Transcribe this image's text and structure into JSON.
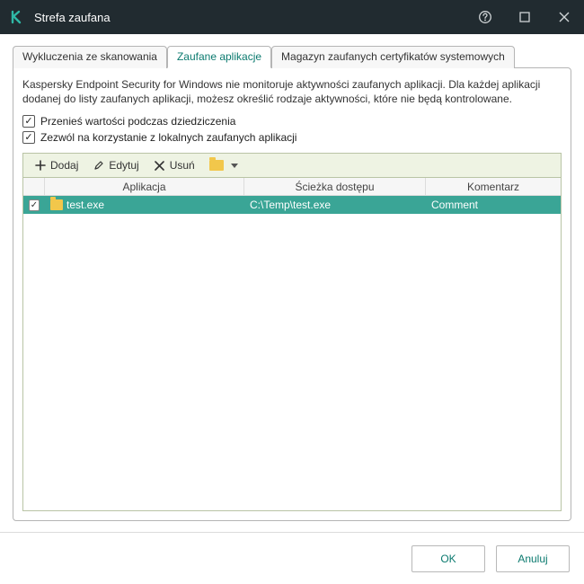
{
  "window": {
    "title": "Strefa zaufana"
  },
  "tabs": {
    "scan_exclusions": "Wykluczenia ze skanowania",
    "trusted_apps": "Zaufane aplikacje",
    "sys_certs": "Magazyn zaufanych certyfikatów systemowych"
  },
  "description": "Kaspersky Endpoint Security for Windows nie monitoruje aktywności zaufanych aplikacji. Dla każdej aplikacji dodanej do listy zaufanych aplikacji, możesz określić rodzaje aktywności, które nie będą kontrolowane.",
  "checks": {
    "inherit": {
      "label": "Przenieś wartości podczas dziedziczenia",
      "checked": true
    },
    "allow_local": {
      "label": "Zezwól na korzystanie z lokalnych zaufanych aplikacji",
      "checked": true
    }
  },
  "toolbar": {
    "add": "Dodaj",
    "edit": "Edytuj",
    "delete": "Usuń"
  },
  "columns": {
    "app": "Aplikacja",
    "path": "Ścieżka dostępu",
    "comment": "Komentarz"
  },
  "rows": [
    {
      "checked": true,
      "app": "test.exe",
      "path": "C:\\Temp\\test.exe",
      "comment": "Comment"
    }
  ],
  "buttons": {
    "ok": "OK",
    "cancel": "Anuluj"
  }
}
